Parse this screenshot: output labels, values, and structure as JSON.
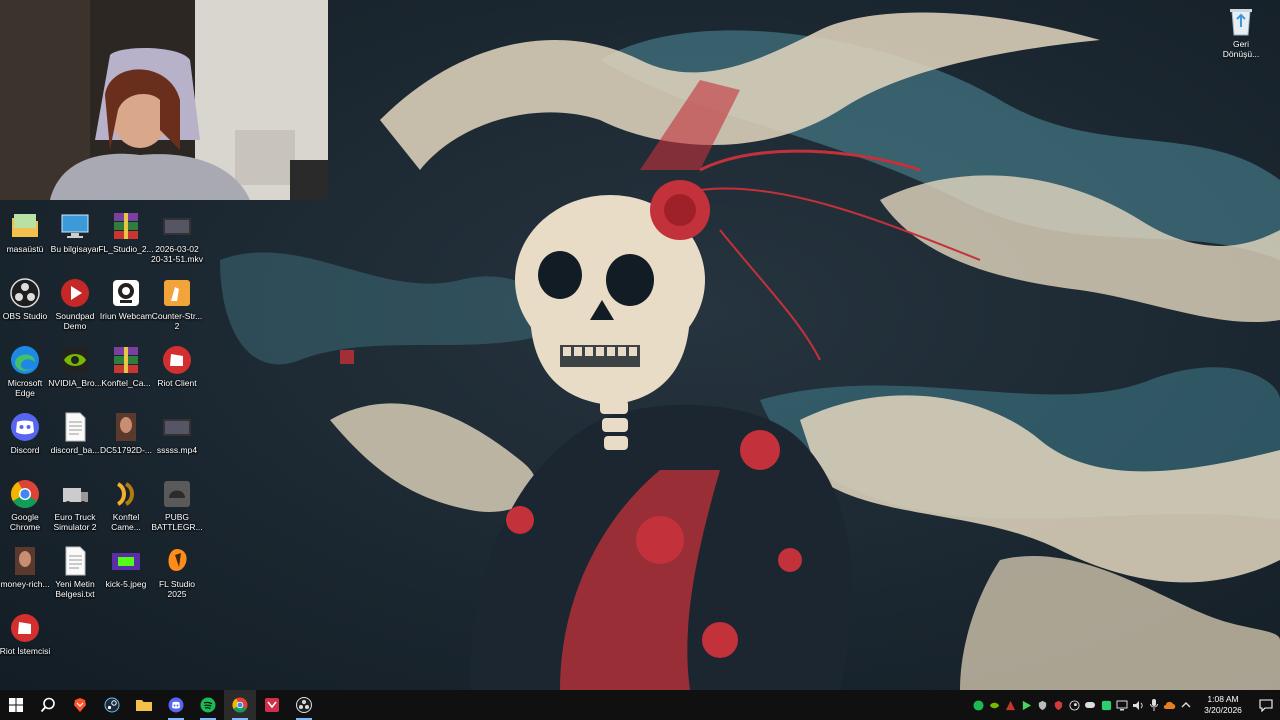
{
  "desktop": {
    "icons": [
      {
        "label": "masaüstü",
        "icon": "folder-icon"
      },
      {
        "label": "Bu bilgisayar",
        "icon": "this-pc-icon"
      },
      {
        "label": "FL_Studio_2...",
        "icon": "winrar-archive-icon"
      },
      {
        "label": "2026-03-02 20-31-51.mkv",
        "icon": "video-thumbnail-icon"
      },
      {
        "label": "OBS Studio",
        "icon": "obs-icon"
      },
      {
        "label": "Soundpad Demo",
        "icon": "soundpad-icon"
      },
      {
        "label": "Iriun Webcam",
        "icon": "iriun-webcam-icon"
      },
      {
        "label": "Counter-Str... 2",
        "icon": "counter-strike-icon"
      },
      {
        "label": "Microsoft Edge",
        "icon": "edge-icon"
      },
      {
        "label": "NVIDIA_Bro...",
        "icon": "nvidia-icon"
      },
      {
        "label": "Konftel_Ca...",
        "icon": "winrar-archive-icon"
      },
      {
        "label": "Riot Client",
        "icon": "riot-client-icon"
      },
      {
        "label": "Discord",
        "icon": "discord-icon"
      },
      {
        "label": "discord_ba...",
        "icon": "text-file-icon"
      },
      {
        "label": "DC51792D-...",
        "icon": "image-thumbnail-icon"
      },
      {
        "label": "sssss.mp4",
        "icon": "video-thumbnail-icon"
      },
      {
        "label": "Google Chrome",
        "icon": "chrome-icon"
      },
      {
        "label": "Euro Truck Simulator 2",
        "icon": "euro-truck-icon"
      },
      {
        "label": "Konftel Came...",
        "icon": "konftel-icon"
      },
      {
        "label": "PUBG BATTLEGR...",
        "icon": "pubg-icon"
      },
      {
        "label": "money-rich...",
        "icon": "image-thumbnail-icon"
      },
      {
        "label": "Yeni Metin Belgesi.txt",
        "icon": "text-file-icon"
      },
      {
        "label": "kick-5.jpeg",
        "icon": "kick-image-icon"
      },
      {
        "label": "FL Studio 2025",
        "icon": "fl-studio-icon"
      },
      {
        "label": "Riot İstemcisi",
        "icon": "riot-client-icon"
      }
    ],
    "recycle_bin": {
      "label": "Geri Dönüşü...",
      "icon": "recycle-bin-icon"
    }
  },
  "taskbar": {
    "pinned": [
      {
        "name": "start-button",
        "icon": "windows-logo-icon"
      },
      {
        "name": "search-button",
        "icon": "search-icon"
      },
      {
        "name": "brave-button",
        "icon": "brave-icon"
      },
      {
        "name": "steam-button",
        "icon": "steam-icon"
      },
      {
        "name": "file-explorer-button",
        "icon": "folder-icon"
      },
      {
        "name": "discord-button",
        "icon": "discord-icon"
      },
      {
        "name": "spotify-button",
        "icon": "spotify-icon"
      },
      {
        "name": "chrome-button",
        "icon": "chrome-icon"
      },
      {
        "name": "app-button",
        "icon": "red-app-icon"
      },
      {
        "name": "obs-button",
        "icon": "obs-icon"
      }
    ],
    "clock": {
      "time": "1:08 AM",
      "date": "3/20/2026"
    }
  },
  "colors": {
    "taskbar": "#101010",
    "accent": "#7fb7ff",
    "wallpaper_dark": "#1a2630",
    "wallpaper_cream": "#e4d7bf",
    "wallpaper_teal": "#4f8e9c",
    "wallpaper_red": "#c3313a"
  }
}
